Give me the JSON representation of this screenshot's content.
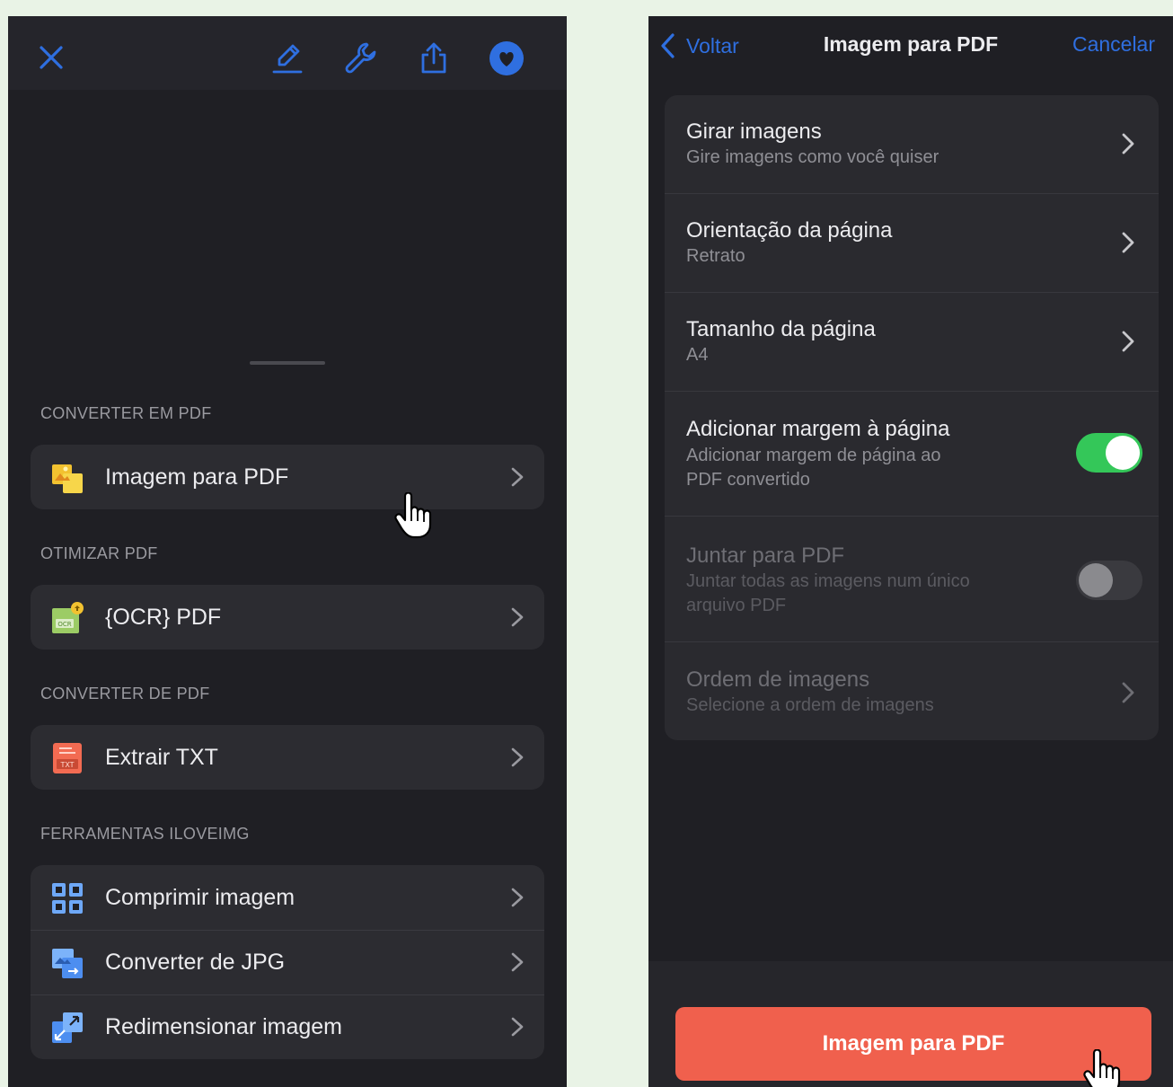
{
  "left": {
    "toolbar": {
      "icons": [
        "close-icon",
        "pen-icon",
        "wrench-icon",
        "share-icon",
        "heart-icon"
      ],
      "accent": "#2f6fe0"
    },
    "sections": [
      {
        "header": "CONVERTER EM PDF",
        "items": [
          {
            "label": "Imagem para PDF",
            "icon": "image-to-pdf-icon"
          }
        ]
      },
      {
        "header": "OTIMIZAR PDF",
        "items": [
          {
            "label": "{OCR} PDF",
            "icon": "ocr-pdf-icon"
          }
        ]
      },
      {
        "header": "CONVERTER DE PDF",
        "items": [
          {
            "label": "Extrair TXT",
            "icon": "extract-txt-icon"
          }
        ]
      },
      {
        "header": "FERRAMENTAS ILOVEIMG",
        "items": [
          {
            "label": "Comprimir imagem",
            "icon": "compress-image-icon"
          },
          {
            "label": "Converter de JPG",
            "icon": "convert-jpg-icon"
          },
          {
            "label": "Redimensionar imagem",
            "icon": "resize-image-icon"
          }
        ]
      }
    ]
  },
  "right": {
    "nav": {
      "back_label": "Voltar",
      "title": "Imagem para PDF",
      "cancel_label": "Cancelar"
    },
    "settings": [
      {
        "title": "Girar imagens",
        "subtitle": "Gire imagens como você quiser",
        "control": "chevron"
      },
      {
        "title": "Orientação da página",
        "subtitle": "Retrato",
        "control": "chevron"
      },
      {
        "title": "Tamanho da página",
        "subtitle": "A4",
        "control": "chevron"
      },
      {
        "title": "Adicionar margem à página",
        "subtitle_lines": [
          "Adicionar margem de página ao",
          "PDF convertido"
        ],
        "control": "toggle",
        "on": true
      },
      {
        "title": "Juntar para PDF",
        "subtitle_lines": [
          "Juntar todas as imagens num único",
          "arquivo PDF"
        ],
        "control": "toggle",
        "on": false,
        "disabled": true
      },
      {
        "title": "Ordem de imagens",
        "subtitle": "Selecione a ordem de imagens",
        "control": "chevron",
        "disabled": true
      }
    ],
    "primary_button": "Imagem para PDF",
    "primary_color": "#f0604d",
    "toggle_on_color": "#34c759"
  }
}
